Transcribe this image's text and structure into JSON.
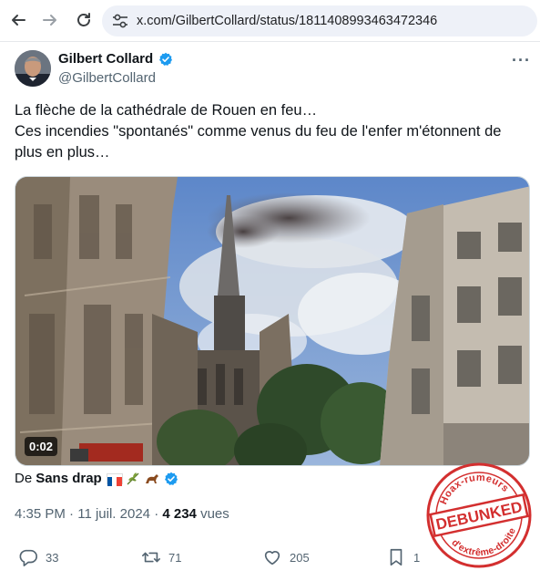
{
  "browser": {
    "url": "x.com/GilbertCollard/status/1811408993463472346"
  },
  "tweet": {
    "author_name": "Gilbert Collard",
    "author_handle": "@GilbertCollard",
    "text_lines": [
      "La flèche de la cathédrale de Rouen en feu…",
      "Ces incendies \"spontanés\" comme venus du feu de l'enfer m'étonnent de",
      "plus en plus…"
    ],
    "video_duration": "0:02",
    "from_prefix": "De",
    "from_account": "Sans drap",
    "time": "4:35 PM",
    "separator": "·",
    "date": "11 juil. 2024",
    "views_count": "4 234",
    "views_label": "vues",
    "replies": "33",
    "retweets": "71",
    "likes": "205",
    "bookmarks": "1"
  },
  "stamp": {
    "top_text": "Hoax-rumeurs",
    "center_text": "DEBUNKED",
    "bottom_text": "d'extrême-droite"
  },
  "colors": {
    "verified_blue": "#1d9bf0",
    "secondary_text": "#536471",
    "stamp_red": "#d32f2f"
  },
  "icons": [
    "back-arrow-icon",
    "forward-arrow-icon",
    "reload-icon",
    "site-settings-icon",
    "verified-badge-icon",
    "more-icon",
    "reply-icon",
    "retweet-icon",
    "like-icon",
    "bookmark-icon"
  ]
}
